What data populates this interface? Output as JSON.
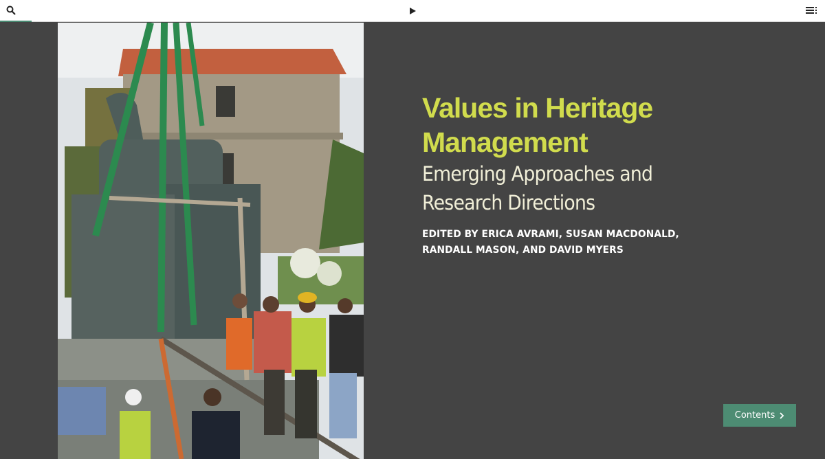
{
  "toolbar": {
    "search_icon": "search-icon",
    "play_icon": "play-icon",
    "menu_icon": "list-menu-icon",
    "accent_color": "#4a8a72"
  },
  "book": {
    "title_line1": "Values in Heritage",
    "title_line2": "Management",
    "subtitle_line1": "Emerging Approaches and",
    "subtitle_line2": "Research Directions",
    "editors_line1": "EDITED BY ERICA AVRAMI, SUSAN MACDONALD,",
    "editors_line2": "RANDALL MASON, AND DAVID MYERS",
    "title_color": "#d1dc4d"
  },
  "contents_button": {
    "label": "Contents",
    "icon": "chevron-right-icon",
    "color": "#4d8c73"
  }
}
